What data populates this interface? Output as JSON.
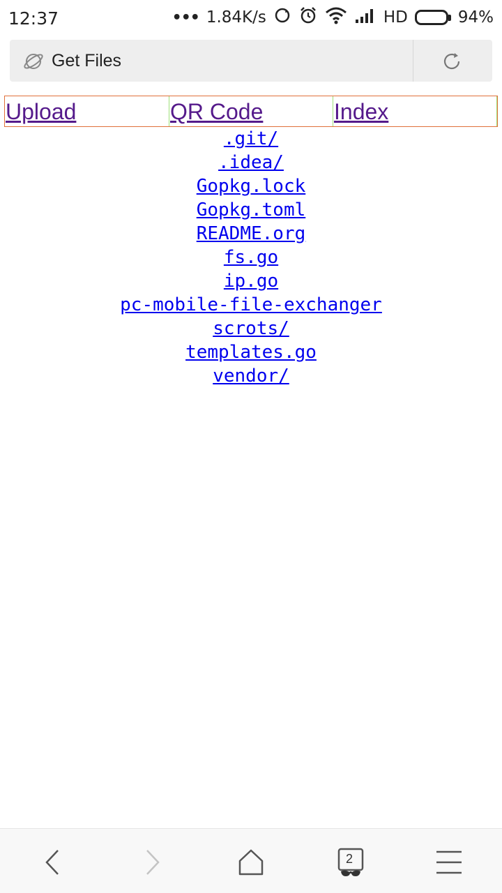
{
  "status_bar": {
    "time": "12:37",
    "dots": "•••",
    "net_speed": "1.84K/s",
    "network_label": "HD",
    "battery_text": "94%",
    "battery_level": 0.94
  },
  "address_bar": {
    "title": "Get Files",
    "icon": "globe-icon",
    "reload_icon": "reload-icon"
  },
  "nav": [
    {
      "label": "Upload"
    },
    {
      "label": "QR Code"
    },
    {
      "label": "Index"
    }
  ],
  "files": [
    ".git/",
    ".idea/",
    "Gopkg.lock",
    "Gopkg.toml",
    "README.org",
    "fs.go",
    "ip.go",
    "pc-mobile-file-exchanger",
    "scrots/",
    "templates.go",
    "vendor/"
  ],
  "bottom_bar": {
    "tab_count": "2",
    "icons": [
      "back-icon",
      "forward-icon",
      "home-icon",
      "tabs-icon",
      "menu-icon"
    ]
  },
  "colors": {
    "visited_link": "#551a8b",
    "link": "#0000ee",
    "table_border": "#e0703a",
    "cell_border": "#9fe07a"
  }
}
